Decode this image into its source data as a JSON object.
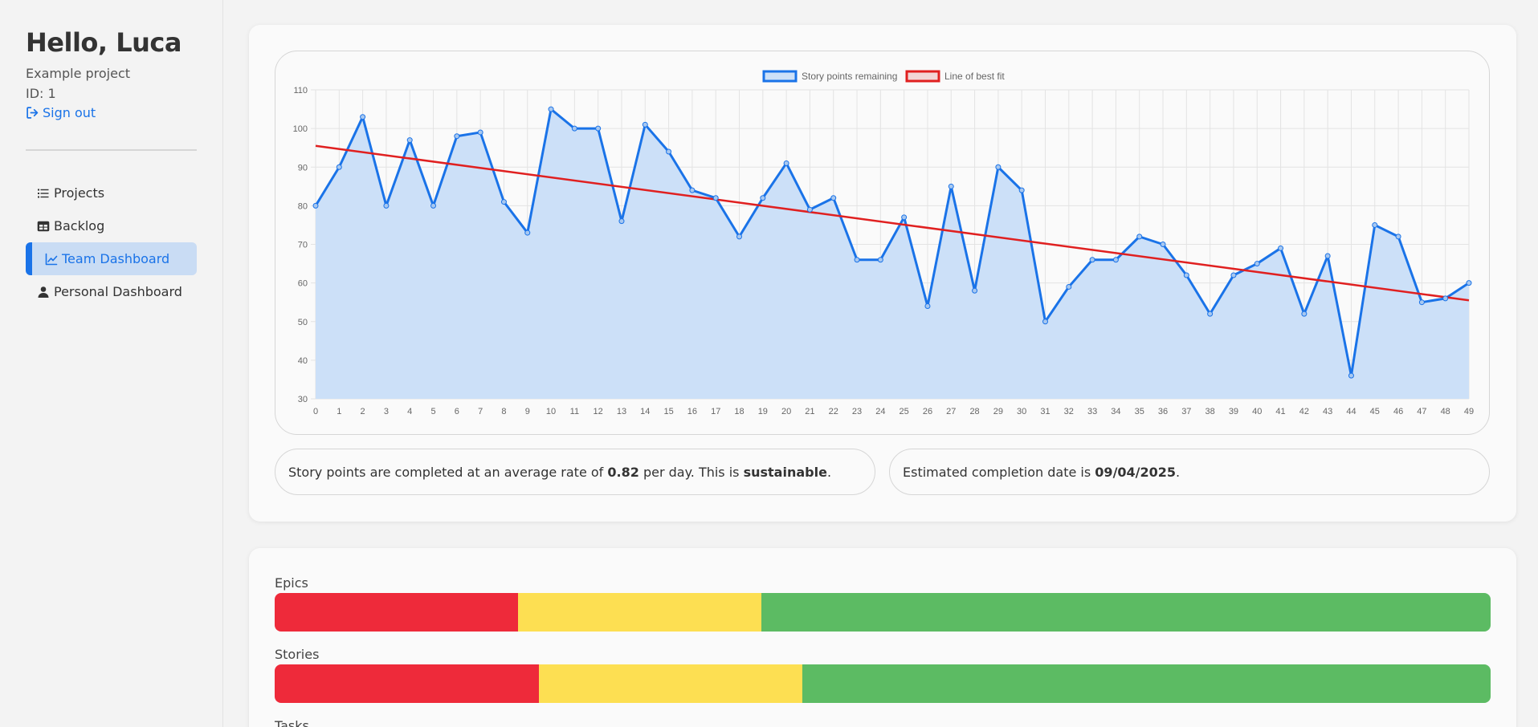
{
  "sidebar": {
    "greeting": "Hello, Luca",
    "project_name": "Example project",
    "project_id": "ID: 1",
    "sign_out": "Sign out",
    "items": [
      {
        "label": "Projects",
        "icon": "list-icon",
        "active": false
      },
      {
        "label": "Backlog",
        "icon": "table-icon",
        "active": false
      },
      {
        "label": "Team Dashboard",
        "icon": "line-chart-icon",
        "active": true
      },
      {
        "label": "Personal Dashboard",
        "icon": "user-icon",
        "active": false
      }
    ]
  },
  "colors": {
    "accent": "#1a73e8",
    "active_bg": "#c9dcf4",
    "series_line": "#1a73e8",
    "series_fill": "#cce0f8",
    "fit_line": "#e02020",
    "red": "#ee2a3a",
    "yellow": "#fddf52",
    "green": "#5cbb63"
  },
  "chart_data": {
    "type": "line",
    "x": [
      0,
      1,
      2,
      3,
      4,
      5,
      6,
      7,
      8,
      9,
      10,
      11,
      12,
      13,
      14,
      15,
      16,
      17,
      18,
      19,
      20,
      21,
      22,
      23,
      24,
      25,
      26,
      27,
      28,
      29,
      30,
      31,
      32,
      33,
      34,
      35,
      36,
      37,
      38,
      39,
      40,
      41,
      42,
      43,
      44,
      45,
      46,
      47,
      48,
      49
    ],
    "series": [
      {
        "name": "Story points remaining",
        "values": [
          80,
          90,
          103,
          80,
          97,
          80,
          98,
          99,
          81,
          73,
          105,
          100,
          100,
          76,
          101,
          94,
          84,
          82,
          72,
          82,
          91,
          79,
          82,
          66,
          66,
          77,
          54,
          85,
          58,
          90,
          84,
          50,
          59,
          66,
          66,
          72,
          70,
          62,
          52,
          62,
          65,
          69,
          52,
          67,
          36,
          75,
          72,
          55,
          56,
          60
        ]
      },
      {
        "name": "Line of best fit",
        "values": [
          95.5,
          55.5
        ],
        "x": [
          0,
          49
        ]
      }
    ],
    "ylim": [
      30,
      110
    ],
    "yticks": [
      30,
      40,
      50,
      60,
      70,
      80,
      90,
      100,
      110
    ],
    "grid": true,
    "legend": "top-center"
  },
  "stats": {
    "rate_prefix": "Story points are completed at an average rate of ",
    "rate_value": "0.82",
    "rate_middle": " per day. This is ",
    "rate_status": "sustainable",
    "rate_suffix": ".",
    "completion_prefix": "Estimated completion date is ",
    "completion_date": "09/04/2025",
    "completion_suffix": "."
  },
  "progress": {
    "epics": {
      "label": "Epics",
      "segments": [
        0.2,
        0.2,
        0.6
      ]
    },
    "stories": {
      "label": "Stories",
      "segments": [
        0.217,
        0.217,
        0.566
      ]
    },
    "tasks": {
      "label": "Tasks"
    }
  }
}
